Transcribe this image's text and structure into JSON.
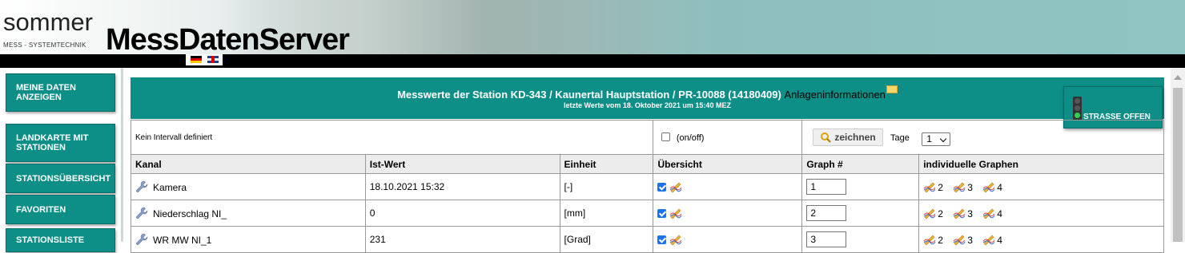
{
  "brand": {
    "logo_text": "sommer",
    "logo_sub": "MESS - SYSTEMTECHNIK",
    "app_title": "MessDatenServer"
  },
  "sidebar": {
    "items": [
      {
        "label": "MEINE DATEN ANZEIGEN"
      },
      {
        "label": "LANDKARTE MIT STATIONEN"
      },
      {
        "label": "STATIONSÜBERSICHT"
      },
      {
        "label": "FAVORITEN"
      },
      {
        "label": "STATIONSLISTE"
      }
    ]
  },
  "panel": {
    "title": "Messwerte der Station KD-343 / Kaunertal Hauptstation / PR-10088 (14180409)",
    "info_link": "Anlageninformationen",
    "subtitle": "letzte Werte vom 18. Oktober 2021 um 15:40 MEZ"
  },
  "traffic_light": {
    "label": "STRASSE OFFEN",
    "active_light": "green"
  },
  "controls": {
    "interval_text": "Kein Intervall definiert",
    "onoff_label": "(on/off)",
    "draw_button": "zeichnen",
    "days_label": "Tage",
    "days_value": "1"
  },
  "table": {
    "headers": [
      "Kanal",
      "Ist-Wert",
      "Einheit",
      "Übersicht",
      "Graph #",
      "individuelle Graphen"
    ],
    "rows": [
      {
        "channel": "Kamera",
        "value": "18.10.2021 15:32",
        "unit": "[-]",
        "graph": "1",
        "graphs": [
          "2",
          "3",
          "4"
        ]
      },
      {
        "channel": "Niederschlag NI_",
        "value": "0",
        "unit": "[mm]",
        "graph": "2",
        "graphs": [
          "2",
          "3",
          "4"
        ]
      },
      {
        "channel": "WR MW NI_1",
        "value": "231",
        "unit": "[Grad]",
        "graph": "3",
        "graphs": [
          "2",
          "3",
          "4"
        ]
      }
    ]
  },
  "colors": {
    "teal": "#0d8e86",
    "header_black_bar": "#000000"
  }
}
